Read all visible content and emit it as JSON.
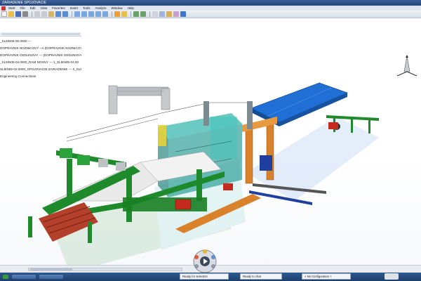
{
  "window": {
    "title": "ZARIADENIE SPOJOVACIE"
  },
  "menu": [
    {
      "label": "Start"
    },
    {
      "label": "File"
    },
    {
      "label": "Edit"
    },
    {
      "label": "View"
    },
    {
      "label": "Favorites"
    },
    {
      "label": "Insert"
    },
    {
      "label": "Tools"
    },
    {
      "label": "Analyze"
    },
    {
      "label": "Window"
    },
    {
      "label": "Help"
    }
  ],
  "tree": {
    "items": [
      {
        "label": "_SL5IN05-00.0000 ---"
      },
      {
        "label": "DOPRAVNIK NOZNICOVY --A (DOPRAVNIK NOZNICOV"
      },
      {
        "label": "DOPRAVNIK ODSUNOVY --- (DOPRAVNIK ODSUNOVY"
      },
      {
        "label": "_SL5IN05-04.0000_RAM NOSNY --- 1_SL5IN05-04.00"
      },
      {
        "label": "SL5IN05-02.0000_SPOJOVACIE ZARIADENIE --- 0_SL5"
      },
      {
        "label": "Engineering Connections"
      }
    ]
  },
  "status": {
    "field1": "Ready for selection",
    "field2": "Ready to chat",
    "config": "< No Configuration >"
  },
  "colors": {
    "frame_green": "#1e8a2c",
    "conveyor_blue": "#1f6fd6",
    "glass_cyan": "#3ab8b0",
    "orange_frame": "#d9822b",
    "taskbar": "#24487c"
  }
}
